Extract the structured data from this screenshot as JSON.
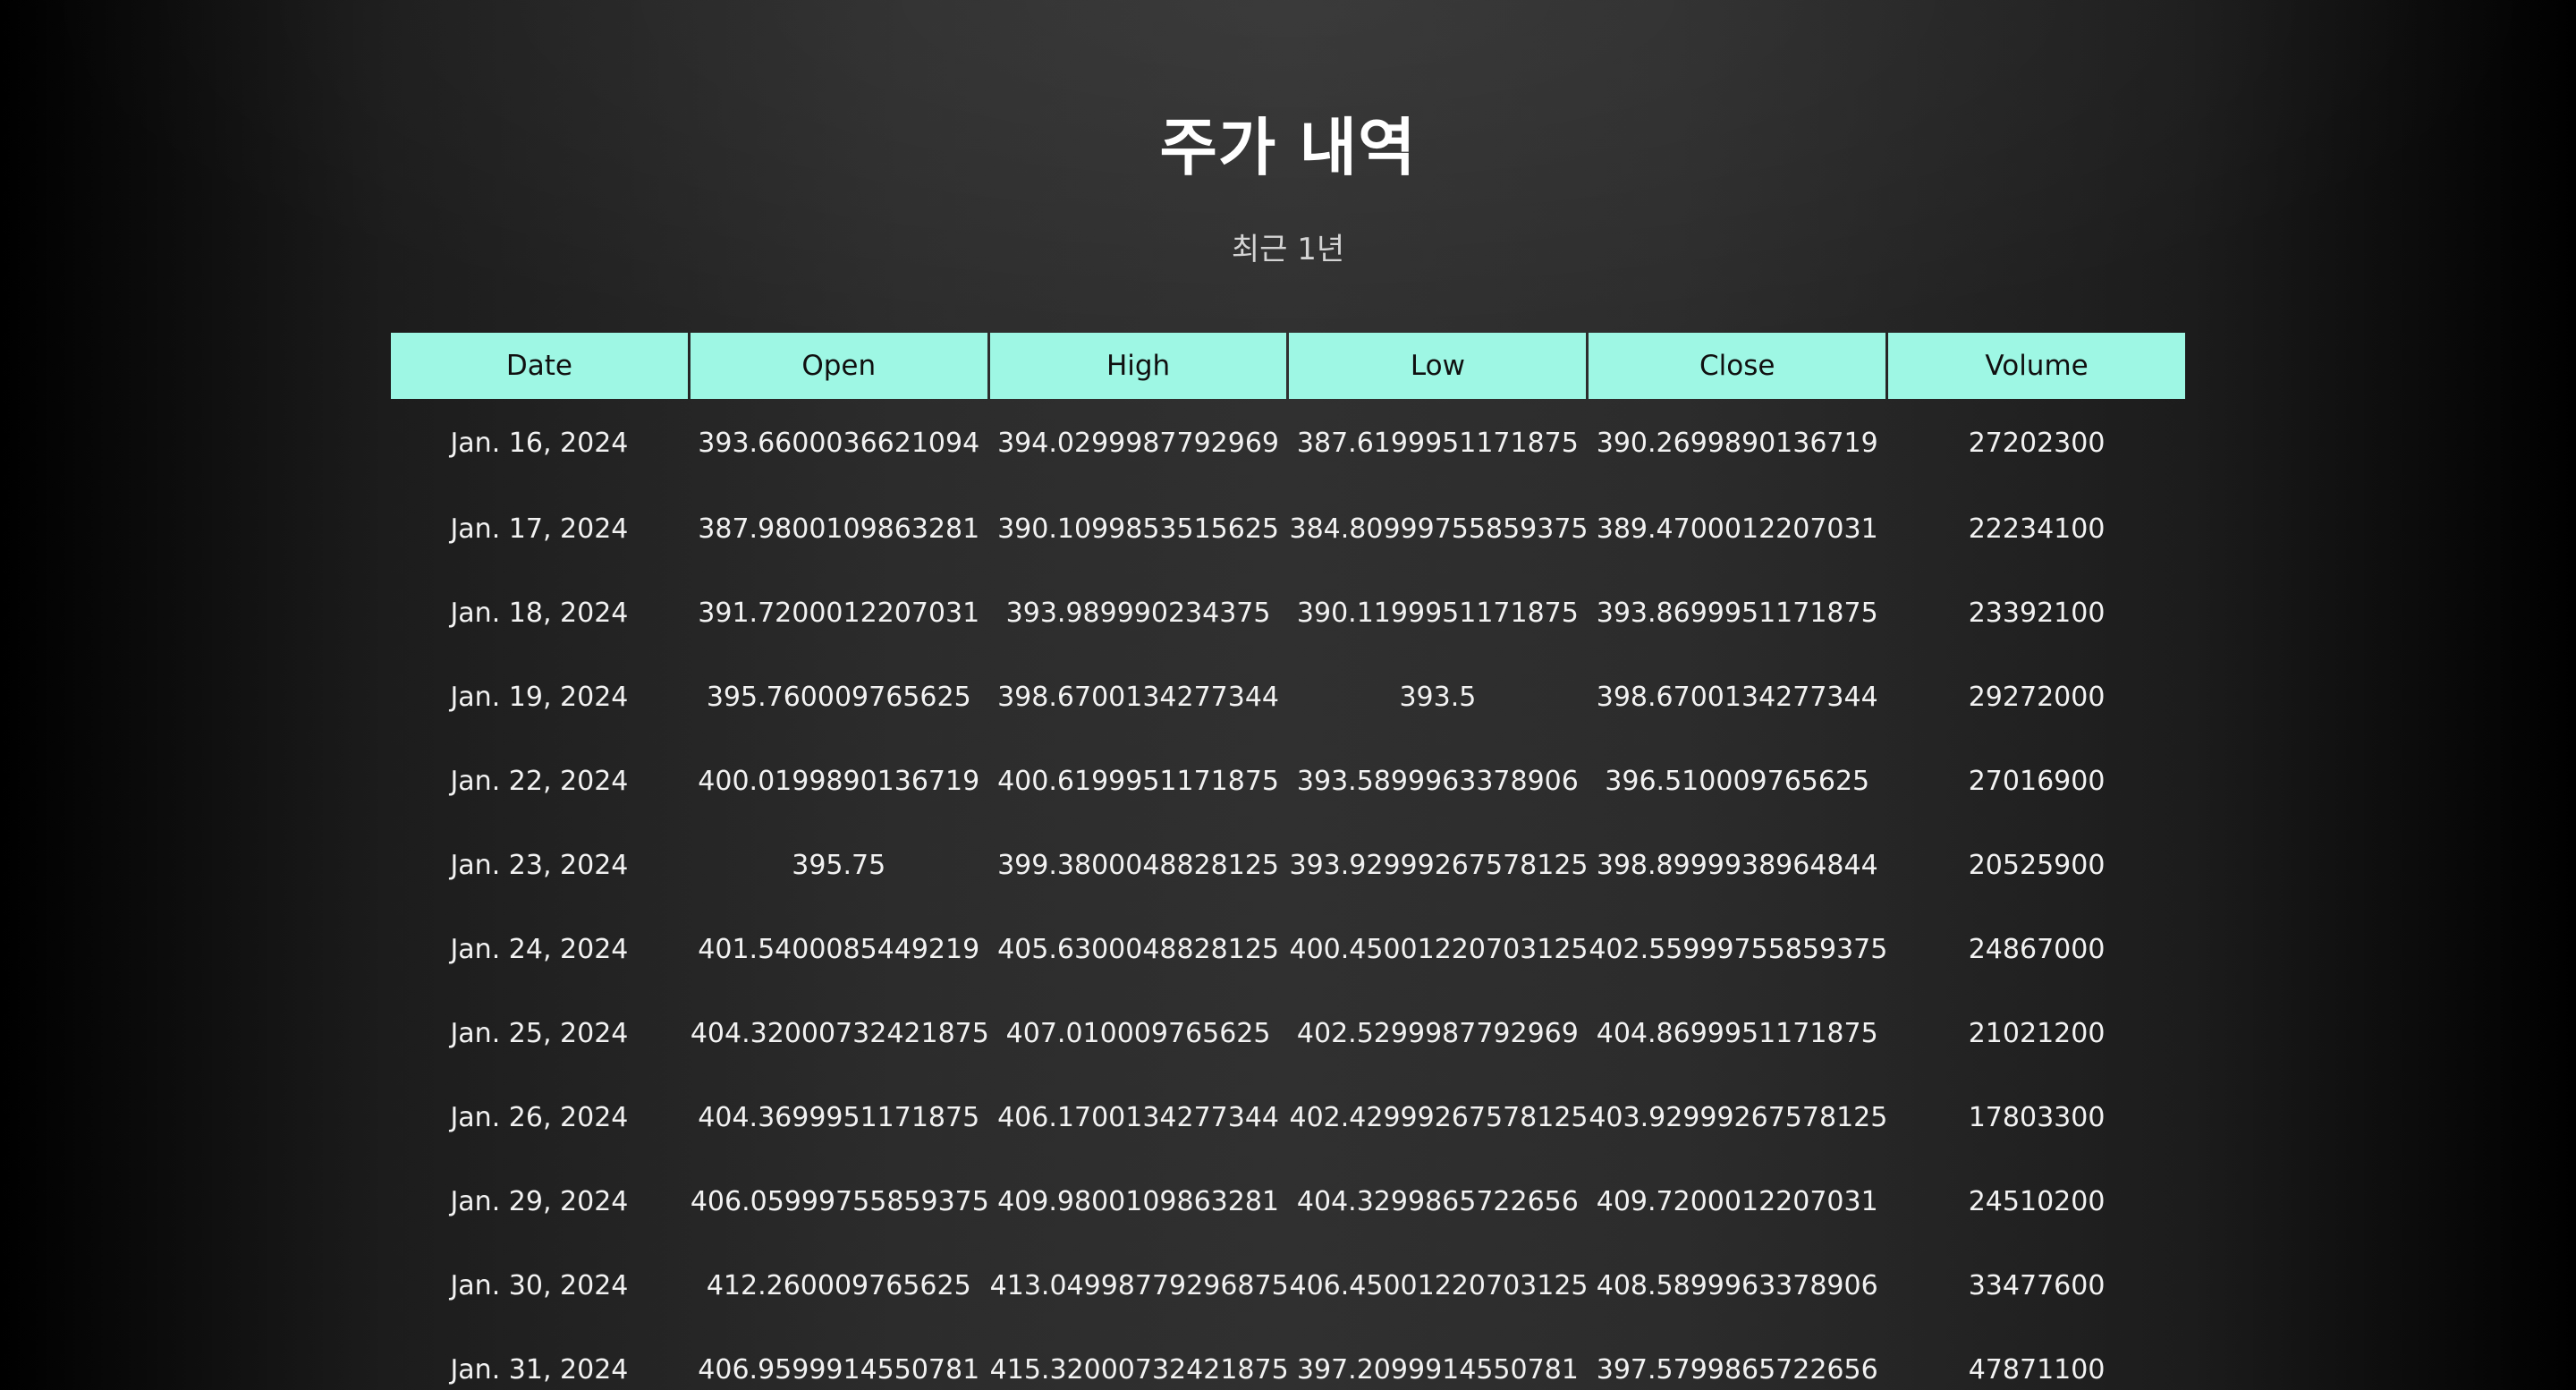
{
  "page": {
    "title": "주가 내역",
    "subtitle": "최근 1년"
  },
  "colors": {
    "header_background": "#9ef7e4",
    "header_text": "#101010",
    "body_text": "#f2f2f2",
    "page_background_center": "#303030",
    "page_background_edge": "#000000"
  },
  "table": {
    "columns": [
      "Date",
      "Open",
      "High",
      "Low",
      "Close",
      "Volume"
    ],
    "rows": [
      [
        "Jan. 16, 2024",
        "393.6600036621094",
        "394.0299987792969",
        "387.6199951171875",
        "390.2699890136719",
        "27202300"
      ],
      [
        "Jan. 17, 2024",
        "387.9800109863281",
        "390.1099853515625",
        "384.80999755859375",
        "389.4700012207031",
        "22234100"
      ],
      [
        "Jan. 18, 2024",
        "391.7200012207031",
        "393.989990234375",
        "390.1199951171875",
        "393.8699951171875",
        "23392100"
      ],
      [
        "Jan. 19, 2024",
        "395.760009765625",
        "398.6700134277344",
        "393.5",
        "398.6700134277344",
        "29272000"
      ],
      [
        "Jan. 22, 2024",
        "400.0199890136719",
        "400.6199951171875",
        "393.5899963378906",
        "396.510009765625",
        "27016900"
      ],
      [
        "Jan. 23, 2024",
        "395.75",
        "399.3800048828125",
        "393.92999267578125",
        "398.8999938964844",
        "20525900"
      ],
      [
        "Jan. 24, 2024",
        "401.5400085449219",
        "405.6300048828125",
        "400.45001220703125",
        "402.55999755859375",
        "24867000"
      ],
      [
        "Jan. 25, 2024",
        "404.32000732421875",
        "407.010009765625",
        "402.5299987792969",
        "404.8699951171875",
        "21021200"
      ],
      [
        "Jan. 26, 2024",
        "404.3699951171875",
        "406.1700134277344",
        "402.42999267578125",
        "403.92999267578125",
        "17803300"
      ],
      [
        "Jan. 29, 2024",
        "406.05999755859375",
        "409.9800109863281",
        "404.3299865722656",
        "409.7200012207031",
        "24510200"
      ],
      [
        "Jan. 30, 2024",
        "412.260009765625",
        "413.04998779296875",
        "406.45001220703125",
        "408.5899963378906",
        "33477600"
      ],
      [
        "Jan. 31, 2024",
        "406.9599914550781",
        "415.32000732421875",
        "397.2099914550781",
        "397.5799865722656",
        "47871100"
      ]
    ]
  }
}
